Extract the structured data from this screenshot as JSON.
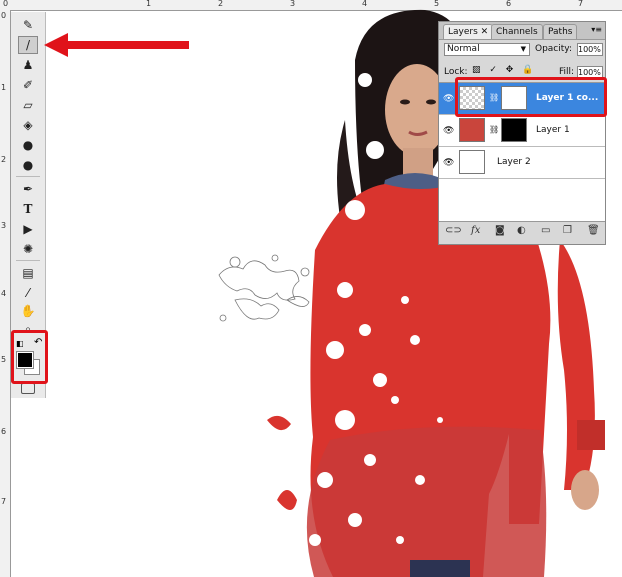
{
  "ruler": {
    "top_labels": [
      "0",
      "1",
      "2",
      "3",
      "4",
      "5",
      "6",
      "7"
    ],
    "left_labels": [
      "0",
      "1",
      "2",
      "3",
      "4",
      "5",
      "6",
      "7"
    ]
  },
  "toolbox": {
    "tools": [
      {
        "name": "healing-brush-icon",
        "glyph": "✎"
      },
      {
        "name": "brush-icon",
        "glyph": "/"
      },
      {
        "name": "clone-stamp-icon",
        "glyph": "♟"
      },
      {
        "name": "history-brush-icon",
        "glyph": "✐"
      },
      {
        "name": "eraser-icon",
        "glyph": "▱"
      },
      {
        "name": "paint-bucket-icon",
        "glyph": "◈"
      },
      {
        "name": "blur-icon",
        "glyph": "●"
      },
      {
        "name": "dodge-icon",
        "glyph": "●"
      },
      {
        "name": "pen-icon",
        "glyph": "✒"
      },
      {
        "name": "type-icon",
        "glyph": "T"
      },
      {
        "name": "path-select-icon",
        "glyph": "▶"
      },
      {
        "name": "custom-shape-icon",
        "glyph": "✺"
      },
      {
        "name": "notes-icon",
        "glyph": "▤"
      },
      {
        "name": "eyedropper-icon",
        "glyph": "⁄"
      },
      {
        "name": "hand-icon",
        "glyph": "✋"
      },
      {
        "name": "zoom-icon",
        "glyph": "⌕"
      }
    ],
    "default_colors_icon": "◧",
    "swap_colors_icon": "↶",
    "foreground_color": "#000000",
    "background_color": "#ffffff"
  },
  "layers_panel": {
    "tabs": [
      "Layers ✕",
      "Channels",
      "Paths"
    ],
    "menu_icon": "▾≡",
    "blend_mode": "Normal",
    "opacity_label": "Opacity:",
    "opacity_value": "100%",
    "lock_label": "Lock:",
    "lock_icons": "▨ ✓ ✥ 🔒",
    "fill_label": "Fill:",
    "fill_value": "100%",
    "layers": [
      {
        "name": "Layer 1 co...",
        "selected": true
      },
      {
        "name": "Layer 1",
        "selected": false
      },
      {
        "name": "Layer 2",
        "selected": false
      }
    ],
    "footer_icons": [
      "⊂⊃",
      "fx",
      "◙",
      "◐",
      "▭",
      "❐",
      "🗑"
    ]
  },
  "colors": {
    "highlight": "#e0131a",
    "selection": "#3b86df",
    "dress": "#d9342e"
  }
}
